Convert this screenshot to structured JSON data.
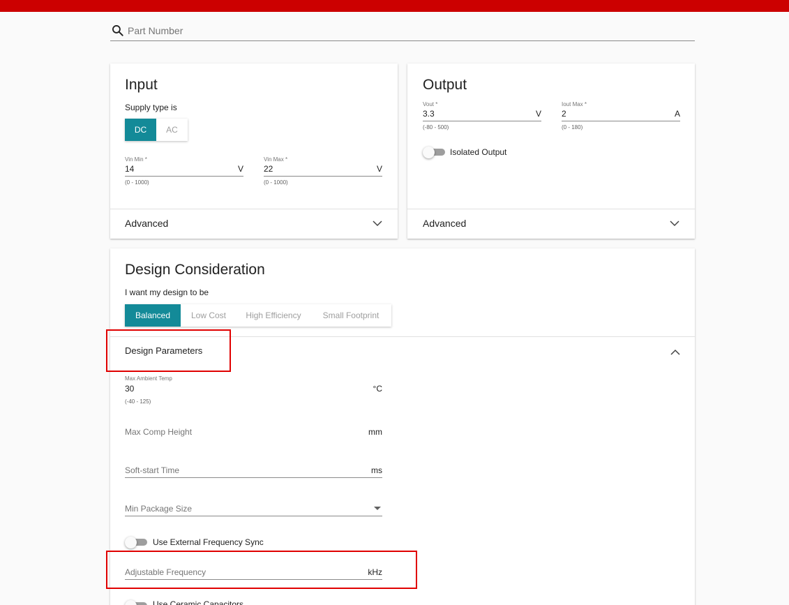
{
  "search": {
    "placeholder": "Part Number"
  },
  "input_card": {
    "title": "Input",
    "supply_label": "Supply type is",
    "supply_options": [
      "DC",
      "AC"
    ],
    "selected_supply": "DC",
    "vin_min": {
      "label": "Vin Min *",
      "value": "14",
      "unit": "V",
      "range": "(0 - 1000)"
    },
    "vin_max": {
      "label": "Vin Max *",
      "value": "22",
      "unit": "V",
      "range": "(0 - 1000)"
    },
    "advanced_label": "Advanced"
  },
  "output_card": {
    "title": "Output",
    "vout": {
      "label": "Vout *",
      "value": "3.3",
      "unit": "V",
      "range": "(-80 - 500)"
    },
    "iout": {
      "label": "Iout Max *",
      "value": "2",
      "unit": "A",
      "range": "(0 - 180)"
    },
    "isolated_label": "Isolated Output",
    "advanced_label": "Advanced"
  },
  "design_card": {
    "title": "Design Consideration",
    "want_label": "I want my design to be",
    "options": [
      "Balanced",
      "Low Cost",
      "High Efficiency",
      "Small Footprint"
    ],
    "selected_option": "Balanced",
    "params_title": "Design Parameters",
    "max_ambient": {
      "label": "Max Ambient Temp",
      "value": "30",
      "unit": "°C",
      "range": "(-40 - 125)"
    },
    "max_comp_height": {
      "label": "Max Comp Height",
      "unit": "mm"
    },
    "soft_start": {
      "label": "Soft-start Time",
      "unit": "ms"
    },
    "min_package": {
      "label": "Min Package Size"
    },
    "ext_freq_label": "Use External Frequency Sync",
    "adj_freq": {
      "label": "Adjustable Frequency",
      "unit": "kHz"
    },
    "ceramic_label": "Use Ceramic Capacitors"
  },
  "colors": {
    "top_bar": "#cc0000",
    "accent": "#138a98",
    "highlight": "#e00000"
  }
}
